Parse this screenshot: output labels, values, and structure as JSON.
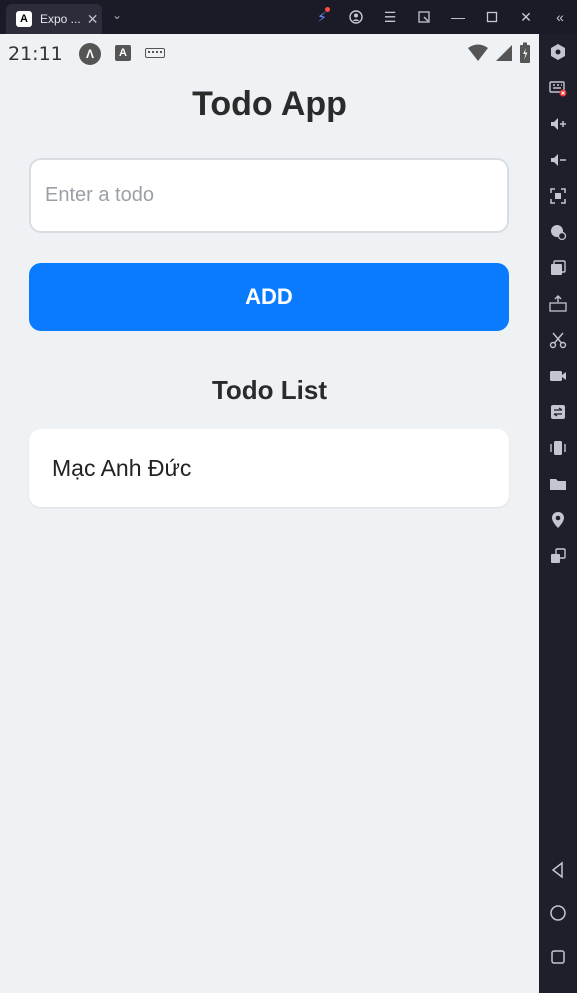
{
  "titlebar": {
    "tab_title": "Expo ...",
    "tab_logo": "A"
  },
  "statusbar": {
    "time": "21:11",
    "app_icon_letter": "A"
  },
  "app": {
    "title": "Todo App",
    "input": {
      "placeholder": "Enter a todo",
      "value": ""
    },
    "add_button_label": "ADD",
    "list_title": "Todo List",
    "todos": [
      "Mạc Anh Đức"
    ]
  },
  "colors": {
    "accent": "#0a7bff",
    "screen_bg": "#eff2f5",
    "frame_bg": "#1f1f2b"
  },
  "sidebar_tools": [
    "settings-icon",
    "keyboard-mapping-icon",
    "volume-up-icon",
    "volume-down-icon",
    "screenshot-icon",
    "location-lock-icon",
    "multi-instance-icon",
    "apk-install-icon",
    "scissors-icon",
    "screen-record-icon",
    "sync-icon",
    "shake-icon",
    "folder-icon",
    "location-icon",
    "rotate-icon",
    "back-nav-icon",
    "home-nav-icon",
    "recents-nav-icon"
  ]
}
